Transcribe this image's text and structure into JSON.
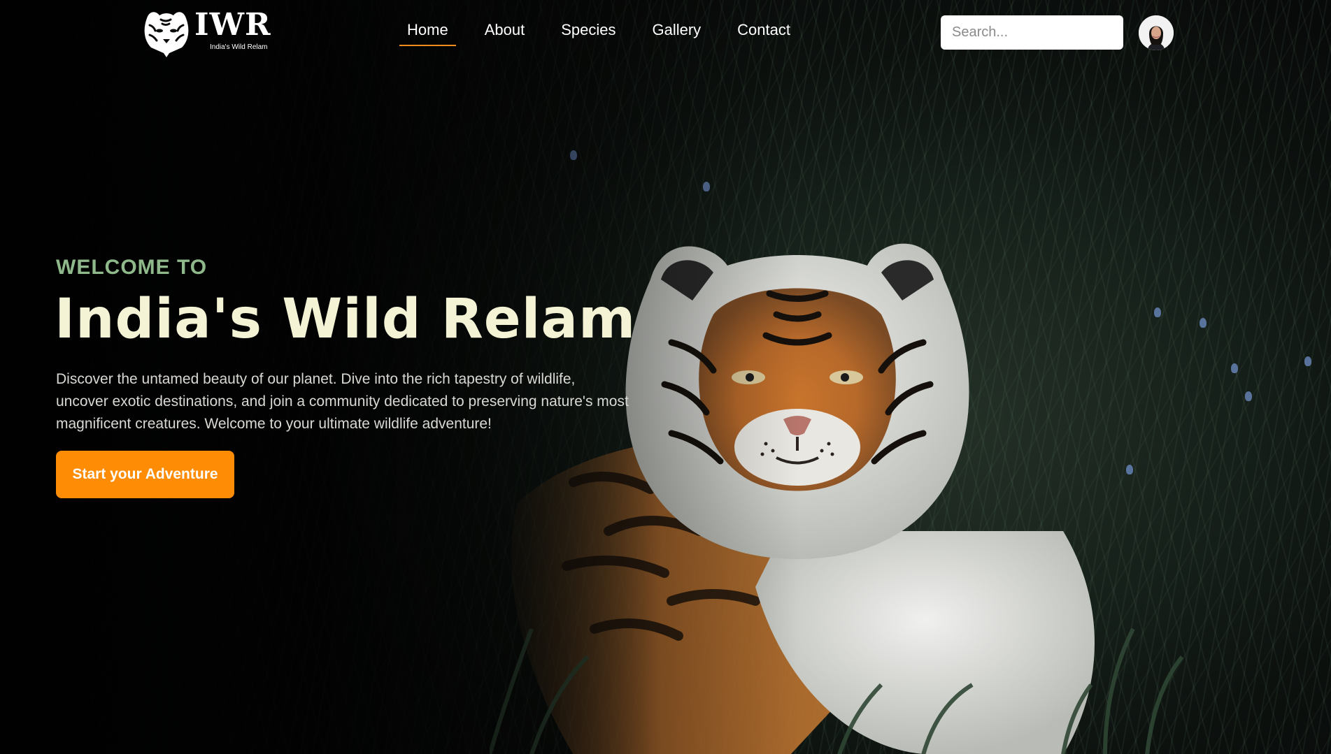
{
  "brand": {
    "logo_text": "IWR",
    "tagline": "India's Wild Relam"
  },
  "nav": {
    "items": [
      {
        "label": "Home",
        "active": true
      },
      {
        "label": "About",
        "active": false
      },
      {
        "label": "Species",
        "active": false
      },
      {
        "label": "Gallery",
        "active": false
      },
      {
        "label": "Contact",
        "active": false
      }
    ]
  },
  "search": {
    "placeholder": "Search..."
  },
  "hero": {
    "eyebrow": "WELCOME TO",
    "title": "India's Wild Relam",
    "description": "Discover the untamed beauty of our planet. Dive into the rich tapestry of wildlife, uncover exotic destinations, and join a community dedicated to preserving nature's most magnificent creatures. Welcome to your ultimate wildlife adventure!",
    "cta_label": "Start your Adventure"
  },
  "colors": {
    "accent": "#ff8c05",
    "eyebrow": "#8fb98a",
    "title": "#f5f3d6",
    "nav_underline": "#f08c1e"
  }
}
